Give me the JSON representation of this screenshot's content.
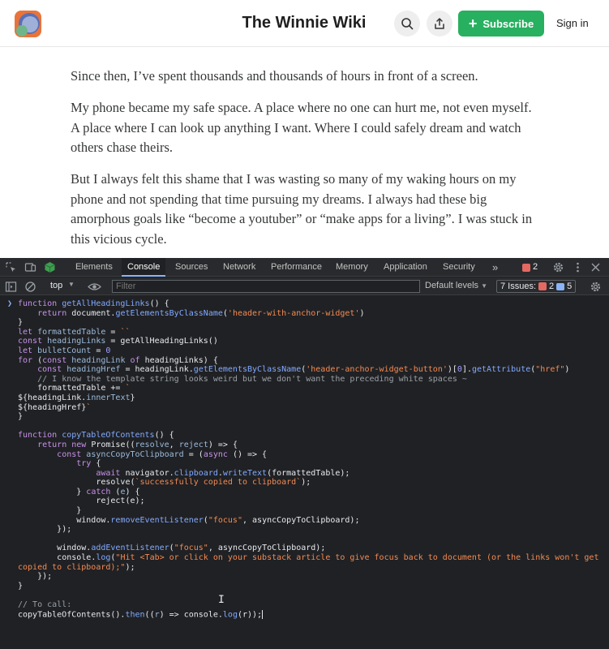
{
  "header": {
    "site_title": "The Winnie Wiki",
    "subscribe_label": "Subscribe",
    "signin_label": "Sign in"
  },
  "article": {
    "paragraphs": [
      "Since then, I’ve spent thousands and thousands of hours in front of a screen.",
      "My phone became my safe space. A place where no one can hurt me, not even myself. A place where I can look up anything I want. Where I could safely dream and watch others chase theirs.",
      "But I always felt this shame that I was wasting so many of my waking hours on my phone and not spending that time pursuing my dreams. I always had these big amorphous goals like “become a youtuber” or “make apps for a living”. I was stuck in this vicious cycle."
    ]
  },
  "devtools": {
    "tabs": [
      "Elements",
      "Console",
      "Sources",
      "Network",
      "Performance",
      "Memory",
      "Application",
      "Security"
    ],
    "active_tab": "Console",
    "more_tabs": "»",
    "error_count": "2",
    "context": "top",
    "filter_placeholder": "Filter",
    "levels_label": "Default levels",
    "issues_label": "7 Issues:",
    "issues_errors": "2",
    "issues_messages": "5",
    "code_lines": [
      [
        [
          "kw",
          "function "
        ],
        [
          "fn",
          "getAllHeadingLinks"
        ],
        [
          "",
          "() {"
        ]
      ],
      [
        [
          "",
          "    "
        ],
        [
          "kw",
          "return "
        ],
        [
          "",
          "document."
        ],
        [
          "fn",
          "getElementsByClassName"
        ],
        [
          "",
          "("
        ],
        [
          "str",
          "'header-with-anchor-widget'"
        ],
        [
          "",
          ")"
        ]
      ],
      [
        [
          "",
          "}"
        ]
      ],
      [
        [
          "kw",
          "let "
        ],
        [
          "var",
          "formattedTable"
        ],
        [
          "",
          " = "
        ],
        [
          "str",
          "``"
        ]
      ],
      [
        [
          "kw",
          "const "
        ],
        [
          "var",
          "headingLinks"
        ],
        [
          "",
          " = getAllHeadingLinks()"
        ]
      ],
      [
        [
          "kw",
          "let "
        ],
        [
          "var",
          "bulletCount"
        ],
        [
          "",
          " = "
        ],
        [
          "num",
          "0"
        ]
      ],
      [
        [
          "kw",
          "for "
        ],
        [
          "",
          "("
        ],
        [
          "kw",
          "const "
        ],
        [
          "var",
          "headingLink "
        ],
        [
          "kw",
          "of "
        ],
        [
          "",
          "headingLinks) {"
        ]
      ],
      [
        [
          "",
          "    "
        ],
        [
          "kw",
          "const "
        ],
        [
          "var",
          "headingHref"
        ],
        [
          "",
          " = headingLink."
        ],
        [
          "fn",
          "getElementsByClassName"
        ],
        [
          "",
          "("
        ],
        [
          "str",
          "'header-anchor-widget-button'"
        ],
        [
          "",
          ")["
        ],
        [
          "num",
          "0"
        ],
        [
          "",
          "]."
        ],
        [
          "fn",
          "getAttribute"
        ],
        [
          "",
          "("
        ],
        [
          "str",
          "\"href\""
        ],
        [
          "",
          ")"
        ]
      ],
      [
        [
          "",
          "    "
        ],
        [
          "cm",
          "// I know the template string looks weird but we don't want the preceding white spaces ~"
        ]
      ],
      [
        [
          "",
          "    formattedTable += "
        ],
        [
          "str",
          "`"
        ]
      ],
      [
        [
          "",
          "${headingLink."
        ],
        [
          "var",
          "innerText"
        ],
        [
          "",
          "}"
        ]
      ],
      [
        [
          "",
          "${headingHref}"
        ],
        [
          "str",
          "`"
        ]
      ],
      [
        [
          "",
          "}"
        ]
      ],
      [
        [
          "",
          ""
        ]
      ],
      [
        [
          "kw",
          "function "
        ],
        [
          "fn",
          "copyTableOfContents"
        ],
        [
          "",
          "() {"
        ]
      ],
      [
        [
          "",
          "    "
        ],
        [
          "kw",
          "return new "
        ],
        [
          "",
          "Promise(("
        ],
        [
          "var",
          "resolve"
        ],
        [
          "",
          ", "
        ],
        [
          "var",
          "reject"
        ],
        [
          "",
          ") => {"
        ]
      ],
      [
        [
          "",
          "        "
        ],
        [
          "kw",
          "const "
        ],
        [
          "var",
          "asyncCopyToClipboard"
        ],
        [
          "",
          " = ("
        ],
        [
          "kw",
          "async "
        ],
        [
          "",
          "() => {"
        ]
      ],
      [
        [
          "",
          "            "
        ],
        [
          "kw",
          "try "
        ],
        [
          "",
          "{"
        ]
      ],
      [
        [
          "",
          "                "
        ],
        [
          "kw",
          "await "
        ],
        [
          "",
          "navigator."
        ],
        [
          "fn",
          "clipboard"
        ],
        [
          "",
          "."
        ],
        [
          "fn",
          "writeText"
        ],
        [
          "",
          "(formattedTable);"
        ]
      ],
      [
        [
          "",
          "                resolve("
        ],
        [
          "str",
          "`successfully copied to clipboard`"
        ],
        [
          "",
          ");"
        ]
      ],
      [
        [
          "",
          "            } "
        ],
        [
          "kw",
          "catch "
        ],
        [
          "",
          "("
        ],
        [
          "var",
          "e"
        ],
        [
          "",
          ") {"
        ]
      ],
      [
        [
          "",
          "                reject(e);"
        ]
      ],
      [
        [
          "",
          "            }"
        ]
      ],
      [
        [
          "",
          "            window."
        ],
        [
          "fn",
          "removeEventListener"
        ],
        [
          "",
          "("
        ],
        [
          "str",
          "\"focus\""
        ],
        [
          "",
          ", asyncCopyToClipboard);"
        ]
      ],
      [
        [
          "",
          "        });"
        ]
      ],
      [
        [
          "",
          ""
        ]
      ],
      [
        [
          "",
          "        window."
        ],
        [
          "fn",
          "addEventListener"
        ],
        [
          "",
          "("
        ],
        [
          "str",
          "\"focus\""
        ],
        [
          "",
          ", asyncCopyToClipboard);"
        ]
      ],
      [
        [
          "",
          "        console."
        ],
        [
          "fn",
          "log"
        ],
        [
          "",
          "("
        ],
        [
          "str",
          "\"Hit <Tab> or click on your substack article to give focus back to document (or the links won't get copied to clipboard);\""
        ],
        [
          "",
          ");"
        ]
      ],
      [
        [
          "",
          "    });"
        ]
      ],
      [
        [
          "",
          "}"
        ]
      ],
      [
        [
          "",
          ""
        ]
      ],
      [
        [
          "cm",
          "// To call:"
        ]
      ],
      [
        [
          "",
          "copyTableOfContents()."
        ],
        [
          "fn",
          "then"
        ],
        [
          "",
          "(("
        ],
        [
          "var",
          "r"
        ],
        [
          "",
          ") => console."
        ],
        [
          "fn",
          "log"
        ],
        [
          "",
          "(r));"
        ]
      ]
    ]
  },
  "colors": {
    "keyword": "#c792ea",
    "function": "#82aaff",
    "string": "#f28b54",
    "number": "#a0a0ff",
    "variable": "#9bbbdc",
    "comment": "#9aa0a6",
    "subscribe": "#27b05f",
    "devtools_bg": "#202124"
  }
}
